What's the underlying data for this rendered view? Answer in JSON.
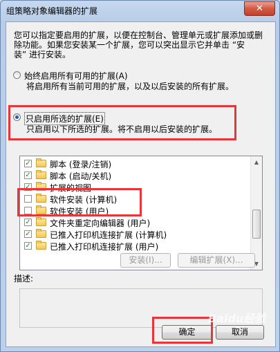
{
  "window": {
    "title": "组策略对象编辑器的扩展",
    "close_glyph": "✕"
  },
  "intro": {
    "line1": "您可以指定要启用的扩展，以便在控制台、管理单元或扩展添加或删",
    "line2": "除功能。如果您安装某一个扩展，您可以突出显示它并单击 “安",
    "line3": "装” 进行安装。"
  },
  "options": {
    "all": {
      "label": "始终启用所有可用的扩展(A)",
      "desc": "将启用所有当前可用的扩展，以及以后安装的所有扩展。",
      "selected": false
    },
    "selected_only": {
      "label": "只启用所选的扩展(E)",
      "desc": "只启用以下所选的扩展。将不启用以后安装的扩展。",
      "selected": true
    }
  },
  "extensions": [
    {
      "label": "脚本 (登录/注销)",
      "checked": true
    },
    {
      "label": "脚本 (启动/关机)",
      "checked": true
    },
    {
      "label": "扩展的视图",
      "checked": true
    },
    {
      "label": "软件安装 (计算机)",
      "checked": false
    },
    {
      "label": "软件安装 (用户)",
      "checked": false
    },
    {
      "label": "文件夹重定向编辑器 (用户)",
      "checked": true
    },
    {
      "label": "已推入打印机连接扩展 (计算机)",
      "checked": true
    },
    {
      "label": "已推入打印机连接扩展 (用户)",
      "checked": true
    }
  ],
  "buttons": {
    "install": "安装(I)...",
    "edit": "编辑扩展(X)...",
    "ok": "确定",
    "cancel": "取消"
  },
  "description_label": "描述:",
  "watermark": "Baidu经验"
}
